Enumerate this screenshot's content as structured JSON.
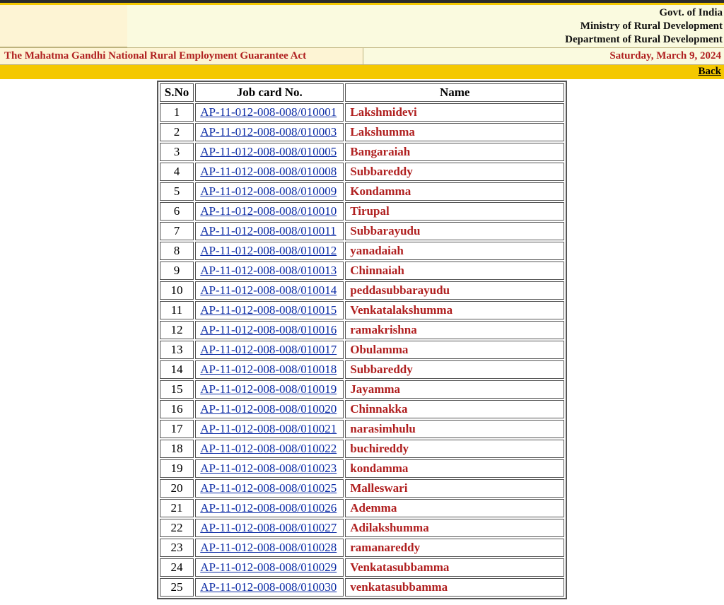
{
  "header": {
    "gov_line1": "Govt. of India",
    "gov_line2": "Ministry of Rural Development",
    "gov_line3": "Department of Rural Development",
    "act_title": "The Mahatma Gandhi National Rural Employment Guarantee Act",
    "date_text": "Saturday, March 9, 2024",
    "back_label": "Back"
  },
  "table": {
    "headers": {
      "sno": "S.No",
      "card": "Job card No.",
      "name": "Name"
    },
    "rows": [
      {
        "sno": "1",
        "card": "AP-11-012-008-008/010001",
        "name": "Lakshmidevi"
      },
      {
        "sno": "2",
        "card": "AP-11-012-008-008/010003",
        "name": "Lakshumma"
      },
      {
        "sno": "3",
        "card": "AP-11-012-008-008/010005",
        "name": "Bangaraiah"
      },
      {
        "sno": "4",
        "card": "AP-11-012-008-008/010008",
        "name": "Subbareddy"
      },
      {
        "sno": "5",
        "card": "AP-11-012-008-008/010009",
        "name": "Kondamma"
      },
      {
        "sno": "6",
        "card": "AP-11-012-008-008/010010",
        "name": "Tirupal"
      },
      {
        "sno": "7",
        "card": "AP-11-012-008-008/010011",
        "name": "Subbarayudu"
      },
      {
        "sno": "8",
        "card": "AP-11-012-008-008/010012",
        "name": "yanadaiah"
      },
      {
        "sno": "9",
        "card": "AP-11-012-008-008/010013",
        "name": "Chinnaiah"
      },
      {
        "sno": "10",
        "card": "AP-11-012-008-008/010014",
        "name": "peddasubbarayudu"
      },
      {
        "sno": "11",
        "card": "AP-11-012-008-008/010015",
        "name": "Venkatalakshumma"
      },
      {
        "sno": "12",
        "card": "AP-11-012-008-008/010016",
        "name": "ramakrishna"
      },
      {
        "sno": "13",
        "card": "AP-11-012-008-008/010017",
        "name": "Obulamma"
      },
      {
        "sno": "14",
        "card": "AP-11-012-008-008/010018",
        "name": "Subbareddy"
      },
      {
        "sno": "15",
        "card": "AP-11-012-008-008/010019",
        "name": "Jayamma"
      },
      {
        "sno": "16",
        "card": "AP-11-012-008-008/010020",
        "name": "Chinnakka"
      },
      {
        "sno": "17",
        "card": "AP-11-012-008-008/010021",
        "name": "narasimhulu"
      },
      {
        "sno": "18",
        "card": "AP-11-012-008-008/010022",
        "name": "buchireddy"
      },
      {
        "sno": "19",
        "card": "AP-11-012-008-008/010023",
        "name": "kondamma"
      },
      {
        "sno": "20",
        "card": "AP-11-012-008-008/010025",
        "name": "Malleswari"
      },
      {
        "sno": "21",
        "card": "AP-11-012-008-008/010026",
        "name": "Ademma"
      },
      {
        "sno": "22",
        "card": "AP-11-012-008-008/010027",
        "name": "Adilakshumma"
      },
      {
        "sno": "23",
        "card": "AP-11-012-008-008/010028",
        "name": "ramanareddy"
      },
      {
        "sno": "24",
        "card": "AP-11-012-008-008/010029",
        "name": "Venkatasubbamma"
      },
      {
        "sno": "25",
        "card": "AP-11-012-008-008/010030",
        "name": "venkatasubbamma"
      }
    ]
  }
}
